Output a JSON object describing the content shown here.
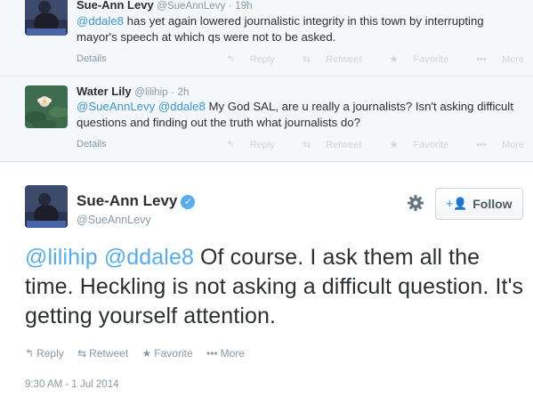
{
  "context_tweets": [
    {
      "name": "Sue-Ann Levy",
      "handle": "@SueAnnLevy",
      "time": "19h",
      "mention": "@ddale8",
      "text": " has yet again lowered journalistic integrity in this town by interrupting mayor's speech at which qs were not to be asked.",
      "details": "Details",
      "actions": {
        "reply": "Reply",
        "retweet": "Retweet",
        "favorite": "Favorite",
        "more": "More"
      }
    },
    {
      "name": "Water Lily",
      "handle": "@lilihip",
      "time": "2h",
      "mention1": "@SueAnnLevy",
      "mention2": "@ddale8",
      "text": " My God SAL, are u really a journalists? Isn't asking difficult questions and finding out the truth what journalists do?",
      "details": "Details",
      "actions": {
        "reply": "Reply",
        "retweet": "Retweet",
        "favorite": "Favorite",
        "more": "More"
      }
    }
  ],
  "main_tweet": {
    "name": "Sue-Ann Levy",
    "handle": "@SueAnnLevy",
    "follow_label": "Follow",
    "mention1": "@lilihip",
    "mention2": "@ddale8",
    "text": " Of course. I ask them all the time. Heckling is not asking a difficult question. It's getting yourself attention.",
    "actions": {
      "reply": "Reply",
      "retweet": "Retweet",
      "favorite": "Favorite",
      "more": "More"
    },
    "timestamp": "9:30 AM - 1 Jul 2014"
  },
  "colors": {
    "link": "#55acee",
    "muted": "#8899a6",
    "context_bg": "#f5f8fa"
  }
}
